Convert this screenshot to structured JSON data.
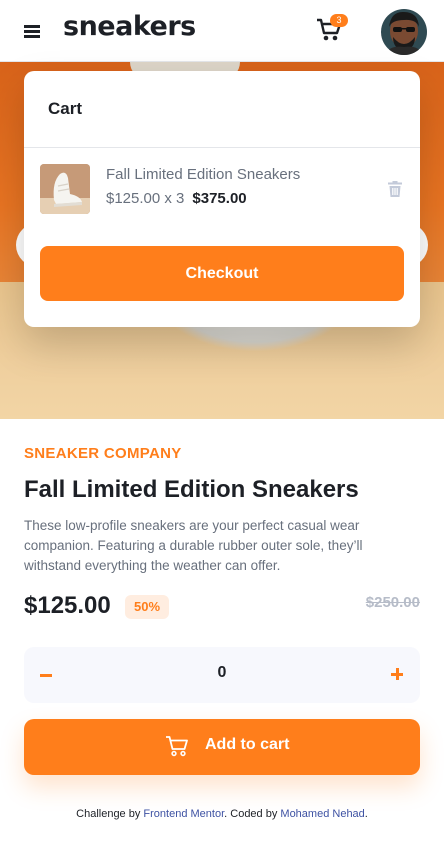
{
  "header": {
    "logo": "sneakers",
    "cart_count": "3",
    "menu_icon": "hamburger-menu-icon",
    "cart_icon": "cart-icon"
  },
  "cart": {
    "title": "Cart",
    "item": {
      "name": "Fall Limited Edition Sneakers",
      "unit_price_qty": "$125.00 x 3",
      "total": "$375.00"
    },
    "checkout_label": "Checkout",
    "delete_icon": "trash-icon"
  },
  "product": {
    "company": "SNEAKER COMPANY",
    "title": "Fall Limited Edition Sneakers",
    "description": "These low-profile sneakers are your perfect casual wear companion. Featuring a durable rubber outer sole, they’ll withstand everything the weather can offer.",
    "price": "$125.00",
    "discount": "50%",
    "original_price": "$250.00"
  },
  "quantity": {
    "value": "0"
  },
  "add_to_cart": {
    "label": "Add to cart"
  },
  "attribution": {
    "prefix": "Challenge by ",
    "challenge_link": "Frontend Mentor",
    "middle": ". Coded by ",
    "author_link": "Mohamed Nehad",
    "suffix": "."
  },
  "colors": {
    "accent": "#ff7e1b",
    "accent_light": "#ffede0",
    "text_dark": "#1d2026",
    "text_muted": "#68707d"
  }
}
